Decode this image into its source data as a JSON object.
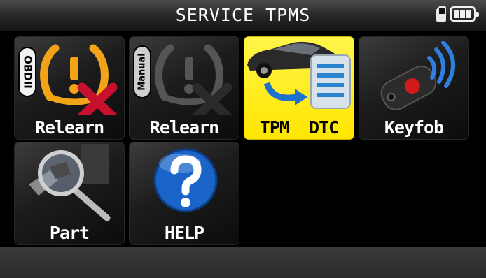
{
  "header": {
    "title": "SERVICE TPMS",
    "icons": [
      "sd-card-icon",
      "battery-icon"
    ],
    "battery_bars": 3
  },
  "menu": {
    "selected_index": 2,
    "items": [
      {
        "label": "Relearn",
        "badge": "OBDII",
        "icon": "tpms-warning-relearn-icon"
      },
      {
        "label": "Relearn",
        "badge": "Manual",
        "icon": "tpms-warning-relearn-icon"
      },
      {
        "label": "TPM  DTC",
        "icon": "car-document-icon"
      },
      {
        "label": "Keyfob",
        "icon": "keyfob-icon"
      },
      {
        "label": "Part",
        "icon": "magnifier-valve-icon"
      },
      {
        "label": "HELP",
        "icon": "question-icon"
      }
    ]
  },
  "colors": {
    "selected_tile": "#ffe600",
    "tile_bg": "#1c1c1c",
    "warning_orange": "#f2a317",
    "cross_red": "#c8102e",
    "help_blue": "#1a64c8"
  }
}
